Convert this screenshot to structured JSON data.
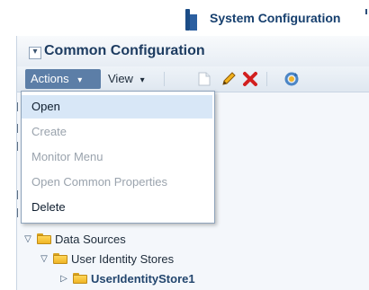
{
  "header": {
    "title": "System Configuration"
  },
  "panel": {
    "title": "Common Configuration",
    "collapse_glyph": "▾"
  },
  "toolbar": {
    "actions_label": "Actions",
    "view_label": "View",
    "chevron": "▾",
    "icons": [
      "new-document-icon",
      "edit-pencil-icon",
      "delete-x-icon",
      "refresh-icon"
    ]
  },
  "actions_menu": {
    "items": [
      {
        "label": "Open",
        "state": "highlighted"
      },
      {
        "label": "Create",
        "state": "disabled"
      },
      {
        "label": "Monitor Menu",
        "state": "disabled"
      },
      {
        "label": "Open Common Properties",
        "state": "disabled"
      },
      {
        "label": "Delete",
        "state": "enabled"
      }
    ]
  },
  "tree": {
    "nodes": [
      {
        "label": "Data Sources",
        "expanded": true,
        "level": 0
      },
      {
        "label": "User Identity Stores",
        "expanded": true,
        "level": 1
      },
      {
        "label": "UserIdentityStore1",
        "expanded": false,
        "level": 2,
        "emphasis": "bold"
      }
    ]
  },
  "colors": {
    "menu_active_bg": "#5c7ea7",
    "highlight_bg": "#d8e7f7",
    "title_text": "#1d3c61"
  }
}
